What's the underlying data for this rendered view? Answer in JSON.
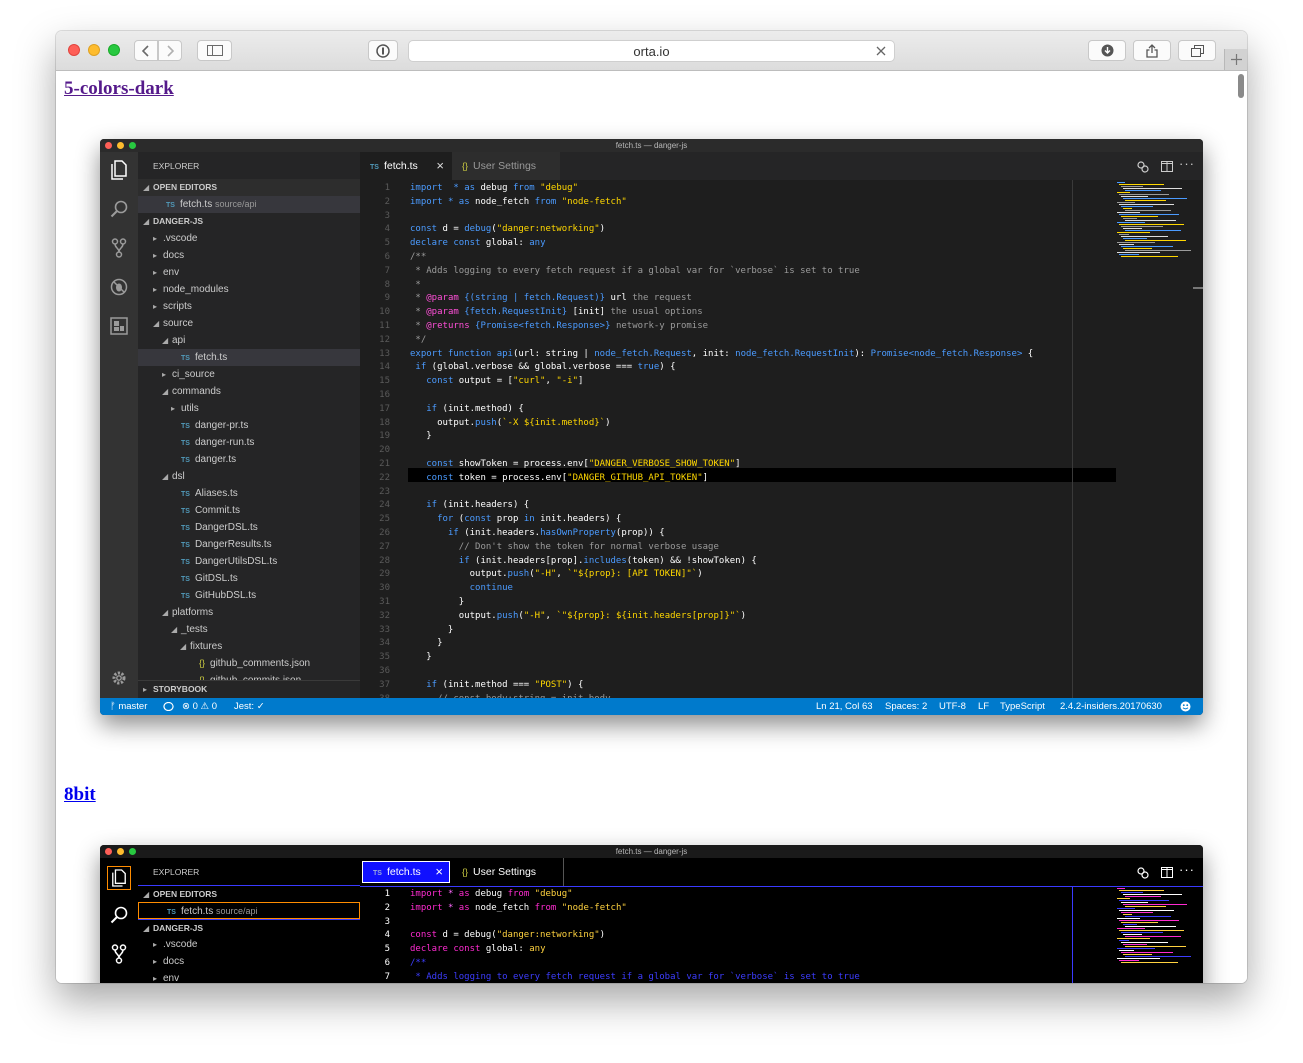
{
  "browser": {
    "url": "orta.io",
    "traffic_colors": {
      "close": "#fe5f57",
      "minimize": "#febc2e",
      "zoom": "#28c840"
    }
  },
  "themes": [
    {
      "name": "5-colors-dark",
      "window_title": "fetch.ts — danger-js",
      "explorer": {
        "title": "EXPLORER",
        "open_editors_label": "OPEN EDITORS",
        "open_editor": {
          "file": "fetch.ts",
          "path": "source/api"
        },
        "project_label": "DANGER-JS",
        "tree": [
          {
            "label": ".vscode",
            "type": "folder",
            "depth": 0,
            "open": false
          },
          {
            "label": "docs",
            "type": "folder",
            "depth": 0,
            "open": false
          },
          {
            "label": "env",
            "type": "folder",
            "depth": 0,
            "open": false
          },
          {
            "label": "node_modules",
            "type": "folder",
            "depth": 0,
            "open": false
          },
          {
            "label": "scripts",
            "type": "folder",
            "depth": 0,
            "open": false
          },
          {
            "label": "source",
            "type": "folder",
            "depth": 0,
            "open": true
          },
          {
            "label": "api",
            "type": "folder",
            "depth": 1,
            "open": true
          },
          {
            "label": "fetch.ts",
            "type": "ts",
            "depth": 2,
            "selected": true
          },
          {
            "label": "ci_source",
            "type": "folder",
            "depth": 1,
            "open": false
          },
          {
            "label": "commands",
            "type": "folder",
            "depth": 1,
            "open": true
          },
          {
            "label": "utils",
            "type": "folder",
            "depth": 2,
            "open": false
          },
          {
            "label": "danger-pr.ts",
            "type": "ts",
            "depth": 2
          },
          {
            "label": "danger-run.ts",
            "type": "ts",
            "depth": 2
          },
          {
            "label": "danger.ts",
            "type": "ts",
            "depth": 2
          },
          {
            "label": "dsl",
            "type": "folder",
            "depth": 1,
            "open": true
          },
          {
            "label": "Aliases.ts",
            "type": "ts",
            "depth": 2
          },
          {
            "label": "Commit.ts",
            "type": "ts",
            "depth": 2
          },
          {
            "label": "DangerDSL.ts",
            "type": "ts",
            "depth": 2
          },
          {
            "label": "DangerResults.ts",
            "type": "ts",
            "depth": 2
          },
          {
            "label": "DangerUtilsDSL.ts",
            "type": "ts",
            "depth": 2
          },
          {
            "label": "GitDSL.ts",
            "type": "ts",
            "depth": 2
          },
          {
            "label": "GitHubDSL.ts",
            "type": "ts",
            "depth": 2
          },
          {
            "label": "platforms",
            "type": "folder",
            "depth": 1,
            "open": true
          },
          {
            "label": "_tests",
            "type": "folder",
            "depth": 2,
            "open": true
          },
          {
            "label": "fixtures",
            "type": "folder",
            "depth": 3,
            "open": true
          },
          {
            "label": "github_comments.json",
            "type": "json",
            "depth": 4
          },
          {
            "label": "github_commits.json",
            "type": "json",
            "depth": 4
          }
        ],
        "storybook_label": "STORYBOOK"
      },
      "tabs": [
        {
          "label": "fetch.ts",
          "icon": "TS",
          "active": true,
          "close": "×"
        },
        {
          "label": "User Settings",
          "icon": "{}",
          "active": false
        }
      ],
      "status": {
        "branch": "master",
        "errors": "0",
        "warnings": "0",
        "jest": "Jest: ✓",
        "position": "Ln 21, Col 63",
        "spaces": "Spaces: 2",
        "encoding": "UTF-8",
        "eol": "LF",
        "language": "TypeScript",
        "version": "2.4.2-insiders.20170630"
      }
    },
    {
      "name": "8bit",
      "window_title": "fetch.ts — danger-js",
      "explorer": {
        "title": "EXPLORER",
        "open_editors_label": "OPEN EDITORS",
        "open_editor": {
          "file": "fetch.ts",
          "path": "source/api"
        },
        "project_label": "DANGER-JS",
        "tree": [
          {
            "label": ".vscode",
            "type": "folder",
            "depth": 0,
            "open": false
          },
          {
            "label": "docs",
            "type": "folder",
            "depth": 0,
            "open": false
          },
          {
            "label": "env",
            "type": "folder",
            "depth": 0,
            "open": false
          }
        ]
      },
      "tabs": [
        {
          "label": "fetch.ts",
          "icon": "TS",
          "active": true,
          "close": "×"
        },
        {
          "label": "User Settings",
          "icon": "{}",
          "active": false
        }
      ]
    }
  ],
  "code": [
    [
      [
        "k",
        "import"
      ],
      [
        "",
        "  "
      ],
      [
        "k",
        "*"
      ],
      [
        "",
        " "
      ],
      [
        "k",
        "as"
      ],
      [
        "",
        " debug "
      ],
      [
        "k",
        "from"
      ],
      [
        "",
        " "
      ],
      [
        "s",
        "\"debug\""
      ]
    ],
    [
      [
        "k",
        "import"
      ],
      [
        "",
        " "
      ],
      [
        "k",
        "*"
      ],
      [
        "",
        " "
      ],
      [
        "k",
        "as"
      ],
      [
        "",
        " node_fetch "
      ],
      [
        "k",
        "from"
      ],
      [
        "",
        " "
      ],
      [
        "s",
        "\"node-fetch\""
      ]
    ],
    [],
    [
      [
        "k",
        "const"
      ],
      [
        "",
        " d = "
      ],
      [
        "f",
        "debug"
      ],
      [
        "",
        "("
      ],
      [
        "s",
        "\"danger:networking\""
      ],
      [
        "",
        ")"
      ]
    ],
    [
      [
        "k",
        "declare const"
      ],
      [
        "",
        " global: "
      ],
      [
        "t",
        "any"
      ]
    ],
    [
      [
        "c",
        "/**"
      ]
    ],
    [
      [
        "c",
        " * Adds logging to every fetch request if a global var for `verbose` is set to true"
      ]
    ],
    [
      [
        "c",
        " *"
      ]
    ],
    [
      [
        "c",
        " * "
      ],
      [
        "p",
        "@param"
      ],
      [
        "",
        " "
      ],
      [
        "k",
        "{(string | fetch.Request)}"
      ],
      [
        "",
        " url "
      ],
      [
        "c",
        "the request"
      ]
    ],
    [
      [
        "c",
        " * "
      ],
      [
        "p",
        "@param"
      ],
      [
        "",
        " "
      ],
      [
        "k",
        "{fetch.RequestInit}"
      ],
      [
        "",
        " [init] "
      ],
      [
        "c",
        "the usual options"
      ]
    ],
    [
      [
        "c",
        " * "
      ],
      [
        "p",
        "@returns"
      ],
      [
        "",
        " "
      ],
      [
        "k",
        "{Promise<fetch.Response>}"
      ],
      [
        "",
        " "
      ],
      [
        "c",
        "network-y promise"
      ]
    ],
    [
      [
        "c",
        " */"
      ]
    ],
    [
      [
        "k",
        "export function"
      ],
      [
        "",
        " "
      ],
      [
        "f",
        "api"
      ],
      [
        "",
        "(url: string | "
      ],
      [
        "t",
        "node_fetch.Request"
      ],
      [
        "",
        ", init: "
      ],
      [
        "t",
        "node_fetch.RequestInit"
      ],
      [
        "",
        "): "
      ],
      [
        "t",
        "Promise<node_fetch.Response>"
      ],
      [
        "",
        " {"
      ]
    ],
    [
      [
        "",
        " "
      ],
      [
        "k",
        "if"
      ],
      [
        "",
        " (global.verbose && global.verbose === "
      ],
      [
        "k",
        "true"
      ],
      [
        "",
        ") {"
      ]
    ],
    [
      [
        "",
        "   "
      ],
      [
        "k",
        "const"
      ],
      [
        "",
        " output = ["
      ],
      [
        "s",
        "\"curl\""
      ],
      [
        "",
        ", "
      ],
      [
        "s",
        "\"-i\""
      ],
      [
        "",
        "]"
      ]
    ],
    [],
    [
      [
        "",
        "   "
      ],
      [
        "k",
        "if"
      ],
      [
        "",
        " (init.method) {"
      ]
    ],
    [
      [
        "",
        "     output."
      ],
      [
        "f",
        "push"
      ],
      [
        "",
        "("
      ],
      [
        "s",
        "`-X ${init.method}`"
      ],
      [
        "",
        ")"
      ]
    ],
    [
      [
        "",
        "   }"
      ]
    ],
    [],
    [
      [
        "",
        "   "
      ],
      [
        "k",
        "const"
      ],
      [
        "",
        " showToken = process.env["
      ],
      [
        "s",
        "\"DANGER_VERBOSE_SHOW_TOKEN\""
      ],
      [
        "",
        "]"
      ]
    ],
    [
      [
        "",
        "   "
      ],
      [
        "k",
        "const"
      ],
      [
        "",
        " token = process.env["
      ],
      [
        "s",
        "\"DANGER_GITHUB_API_TOKEN\""
      ],
      [
        "",
        "]"
      ]
    ],
    [],
    [
      [
        "",
        "   "
      ],
      [
        "k",
        "if"
      ],
      [
        "",
        " (init.headers) {"
      ]
    ],
    [
      [
        "",
        "     "
      ],
      [
        "k",
        "for"
      ],
      [
        "",
        " ("
      ],
      [
        "k",
        "const"
      ],
      [
        "",
        " prop "
      ],
      [
        "k",
        "in"
      ],
      [
        "",
        " init.headers) {"
      ]
    ],
    [
      [
        "",
        "       "
      ],
      [
        "k",
        "if"
      ],
      [
        "",
        " (init.headers."
      ],
      [
        "f",
        "hasOwnProperty"
      ],
      [
        "",
        "(prop)) {"
      ]
    ],
    [
      [
        "",
        "         "
      ],
      [
        "c",
        "// Don't show the token for normal verbose usage"
      ]
    ],
    [
      [
        "",
        "         "
      ],
      [
        "k",
        "if"
      ],
      [
        "",
        " (init.headers[prop]."
      ],
      [
        "f",
        "includes"
      ],
      [
        "",
        "(token) && !showToken) {"
      ]
    ],
    [
      [
        "",
        "           output."
      ],
      [
        "f",
        "push"
      ],
      [
        "",
        "("
      ],
      [
        "s",
        "\"-H\""
      ],
      [
        "",
        ", "
      ],
      [
        "s",
        "`\"${prop}: [API TOKEN]\"`"
      ],
      [
        "",
        ")"
      ]
    ],
    [
      [
        "",
        "           "
      ],
      [
        "k",
        "continue"
      ]
    ],
    [
      [
        "",
        "         }"
      ]
    ],
    [
      [
        "",
        "         output."
      ],
      [
        "f",
        "push"
      ],
      [
        "",
        "("
      ],
      [
        "s",
        "\"-H\""
      ],
      [
        "",
        ", "
      ],
      [
        "s",
        "`\"${prop}: ${init.headers[prop]}\"`"
      ],
      [
        "",
        ")"
      ]
    ],
    [
      [
        "",
        "       }"
      ]
    ],
    [
      [
        "",
        "     }"
      ]
    ],
    [
      [
        "",
        "   }"
      ]
    ],
    [],
    [
      [
        "",
        "   "
      ],
      [
        "k",
        "if"
      ],
      [
        "",
        " (init.method === "
      ],
      [
        "s",
        "\"POST\""
      ],
      [
        "",
        ") {"
      ]
    ],
    [
      [
        "",
        "     "
      ],
      [
        "c",
        "// const body:string = init.body"
      ]
    ]
  ],
  "code_8bit": [
    [
      [
        "k",
        "import"
      ],
      [
        "",
        " "
      ],
      [
        "n8",
        "*"
      ],
      [
        "",
        " "
      ],
      [
        "k",
        "as"
      ],
      [
        "",
        " debug "
      ],
      [
        "k",
        "from"
      ],
      [
        "",
        " "
      ],
      [
        "s",
        "\"debug\""
      ]
    ],
    [
      [
        "k",
        "import"
      ],
      [
        "",
        " "
      ],
      [
        "n8",
        "*"
      ],
      [
        "",
        " "
      ],
      [
        "k",
        "as"
      ],
      [
        "",
        " node_fetch "
      ],
      [
        "k",
        "from"
      ],
      [
        "",
        " "
      ],
      [
        "s",
        "\"node-fetch\""
      ]
    ],
    [],
    [
      [
        "k",
        "const"
      ],
      [
        "",
        " d = debug("
      ],
      [
        "s",
        "\"danger:networking\""
      ],
      [
        "",
        ")"
      ]
    ],
    [
      [
        "k",
        "declare const"
      ],
      [
        "",
        " global: "
      ],
      [
        "s",
        "any"
      ]
    ],
    [
      [
        "c",
        "/**"
      ]
    ],
    [
      [
        "c",
        " * Adds logging to every fetch request if a global var for `verbose` is set to true"
      ]
    ]
  ]
}
